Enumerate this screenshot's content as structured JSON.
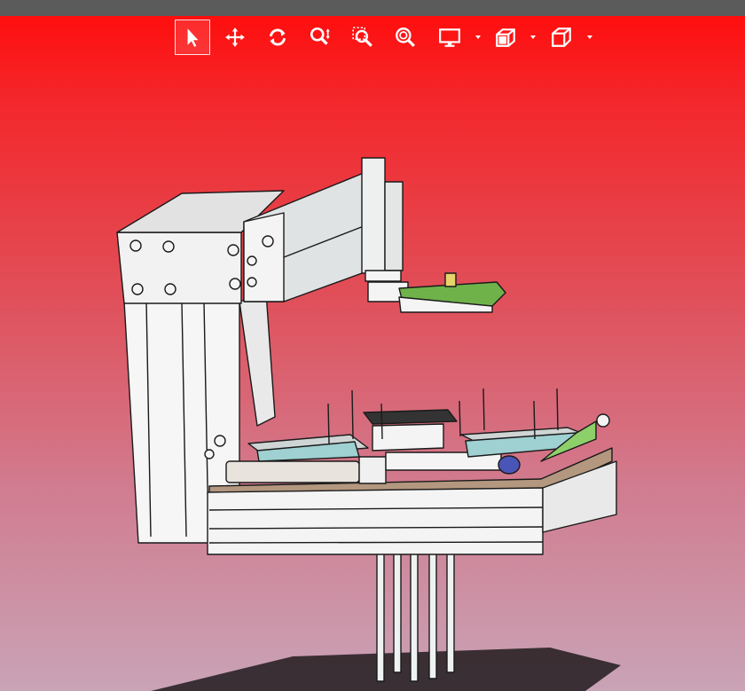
{
  "toolbar": {
    "buttons": [
      {
        "id": "select",
        "icon": "cursor-arrow-icon",
        "active": true
      },
      {
        "id": "pan",
        "icon": "move-arrows-icon",
        "active": false
      },
      {
        "id": "rotate",
        "icon": "rotate-icon",
        "active": false
      },
      {
        "id": "zoom",
        "icon": "zoom-icon",
        "active": false
      },
      {
        "id": "zoom-window",
        "icon": "zoom-window-icon",
        "active": false
      },
      {
        "id": "zoom-fit",
        "icon": "zoom-fit-icon",
        "active": false
      },
      {
        "id": "display",
        "icon": "monitor-icon",
        "active": false,
        "dropdown": true
      },
      {
        "id": "section",
        "icon": "section-cube-icon",
        "active": false,
        "dropdown": true
      },
      {
        "id": "view",
        "icon": "view-cube-icon",
        "active": false,
        "dropdown": true
      }
    ]
  },
  "colors": {
    "topbar": "#5b5b5b",
    "background_top": "#ff0e0e",
    "background_bottom": "#c9a3b6",
    "part_fill": "#f4f4f4",
    "pcb_green": "#6fb24a",
    "base_plate": "#b3977f",
    "fitting_blue": "#4a55b8"
  }
}
